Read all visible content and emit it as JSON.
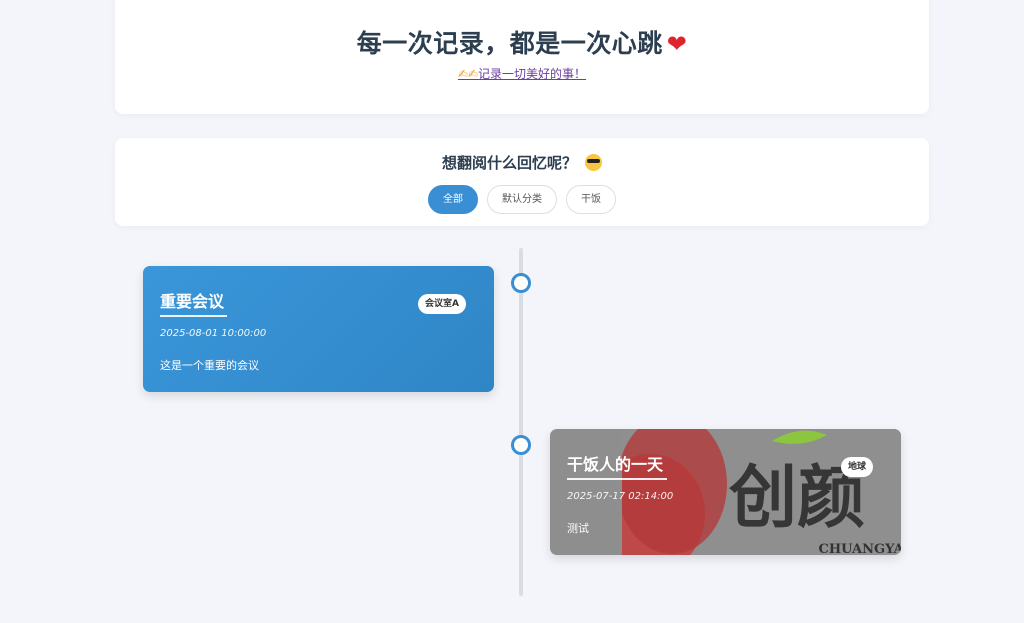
{
  "header": {
    "title": "每一次记录，都是一次心跳",
    "heart": "❤",
    "link_icons": "✍✍",
    "link_text": "记录一切美好的事！"
  },
  "filter": {
    "title": "想翻阅什么回忆呢？",
    "emoji": "sunglasses-face-icon",
    "options": [
      "全部",
      "默认分类",
      "干饭"
    ],
    "selected": "全部"
  },
  "events": [
    {
      "title": "重要会议",
      "tag": "会议室A",
      "date": "2025-08-01 10:00:00",
      "desc": "这是一个重要的会议",
      "color": "#3a8fd4"
    },
    {
      "title": "干饭人的一天",
      "tag": "地球",
      "date": "2025-07-17 02:14:00",
      "desc": "测试",
      "bg_image_text_main": "创颜",
      "bg_image_text_sub": "CHUANGYAN"
    }
  ],
  "colors": {
    "accent": "#3a8fd4",
    "page_bg": "#f3f5fa",
    "title": "#2c3e50"
  }
}
